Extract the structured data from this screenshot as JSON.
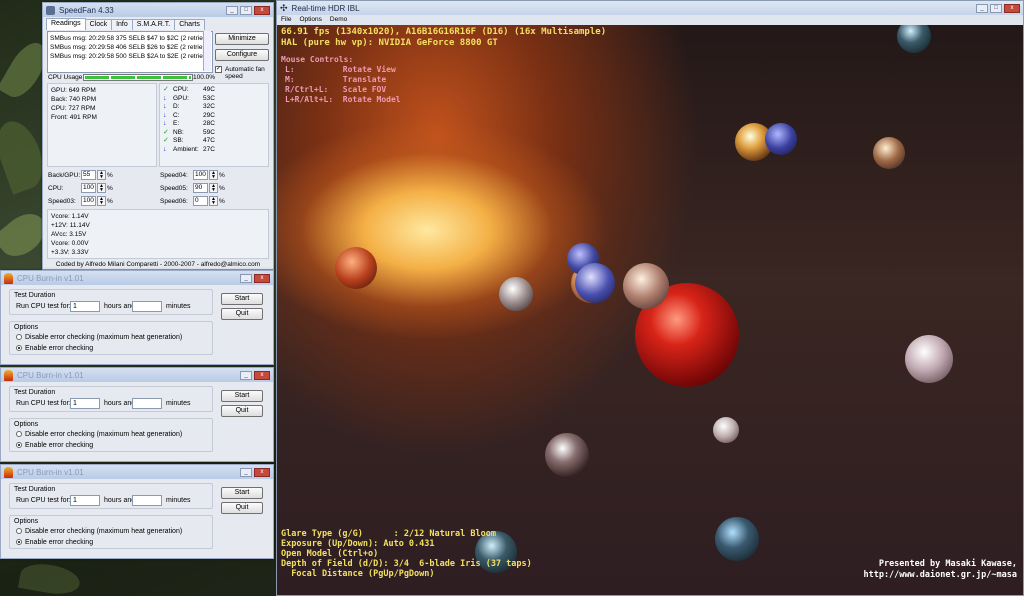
{
  "speedfan": {
    "title": "SpeedFan 4.33",
    "tabs": [
      "Readings",
      "Clock",
      "Info",
      "S.M.A.R.T.",
      "Charts"
    ],
    "log": [
      "SMBus msg: 20:29:58 375 SELB $47 to $2C (2 retries)",
      "SMBus msg: 20:29:58 406 SELB $26 to $2E (2 retries)",
      "SMBus msg: 20:29:58 500 SELB $2A to $2E (2 retries)"
    ],
    "minimize_label": "Minimize",
    "configure_label": "Configure",
    "auto_fan_label": "Automatic fan speed",
    "cpu_usage_label": "CPU Usage",
    "cpu_usage_value": "100.0%",
    "cpu_usage_fraction": 1.0,
    "fans": [
      "GPU:  649 RPM",
      "Back: 740 RPM",
      "CPU:  727 RPM",
      "Front: 491 RPM"
    ],
    "temps": [
      {
        "icon": "check",
        "name": "CPU:",
        "value": "49C"
      },
      {
        "icon": "down",
        "name": "GPU:",
        "value": "53C"
      },
      {
        "icon": "down",
        "name": "D:",
        "value": "32C"
      },
      {
        "icon": "down",
        "name": "C:",
        "value": "29C"
      },
      {
        "icon": "down",
        "name": "E:",
        "value": "28C"
      },
      {
        "icon": "check",
        "name": "NB:",
        "value": "59C"
      },
      {
        "icon": "check",
        "name": "SB:",
        "value": "47C"
      },
      {
        "icon": "down",
        "name": "Ambient:",
        "value": "27C"
      }
    ],
    "speeds_left": [
      {
        "label": "Back/GPU:",
        "value": "55"
      },
      {
        "label": "CPU:",
        "value": "100"
      },
      {
        "label": "Speed03:",
        "value": "100"
      }
    ],
    "speeds_right": [
      {
        "label": "Speed04:",
        "value": "100"
      },
      {
        "label": "Speed05:",
        "value": "90"
      },
      {
        "label": "Speed06:",
        "value": "0"
      }
    ],
    "percent": "%",
    "volts": [
      "Vcore:   1.14V",
      "+12V:  11.14V",
      "AVcc:    3.15V",
      "Vcore:   0.00V",
      "+3.3V:   3.33V"
    ],
    "footer": "Coded by Alfredo Milani Comparetti - 2000-2007 - alfredo@almico.com"
  },
  "burnin": {
    "title": "CPU Burn-in v1.01",
    "test_duration_label": "Test Duration",
    "run_label": "Run CPU test for:",
    "hours_value": "1",
    "hours_label": "hours and",
    "minutes_value": "",
    "minutes_label": "minutes",
    "start_label": "Start",
    "quit_label": "Quit",
    "options_label": "Options",
    "option_disable": "Disable error checking (maximum heat generation)",
    "option_enable": "Enable error checking"
  },
  "hdr": {
    "title": "Real-time HDR IBL",
    "menu": [
      "File",
      "Options",
      "Demo"
    ],
    "stats_line1": "66.91 fps (1340x1020), A16B16G16R16F (D16) (16x Multisample)",
    "stats_line2": "HAL (pure hw vp): NVIDIA GeForce 8800 GT",
    "mouse_title": "Mouse Controls:",
    "mouse_lines": [
      "L:          Rotate View",
      "M:          Translate",
      "R/Ctrl+L:   Scale FOV",
      "L+R/Alt+L:  Rotate Model"
    ],
    "bottom_lines": [
      "Glare Type (g/G)      : 2/12 Natural Bloom",
      "Exposure (Up/Down): Auto 0.431",
      "Open Model (Ctrl+o)",
      "Depth of Field (d/D): 3/4  6-blade Iris (37 taps)",
      "  Focal Distance (PgUp/PgDown)"
    ],
    "credit1": "Presented by Masaki Kawase,",
    "credit2": "http://www.daionet.gr.jp/~masa",
    "colors": {
      "hud_yellow": "#f2e060",
      "hud_pink": "#f09ab4",
      "credit_white": "#ffffff"
    }
  }
}
